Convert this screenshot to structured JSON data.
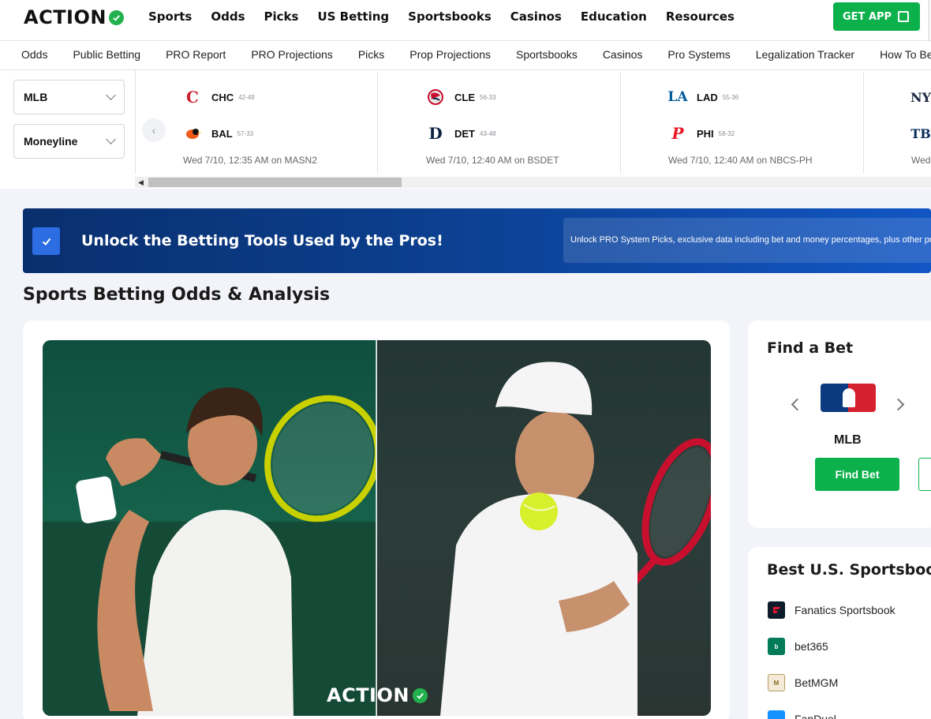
{
  "header": {
    "logo": "ACTION",
    "nav": [
      "Sports",
      "Odds",
      "Picks",
      "US Betting",
      "Sportsbooks",
      "Casinos",
      "Education",
      "Resources"
    ],
    "cta": "GET APP"
  },
  "subnav": [
    "Odds",
    "Public Betting",
    "PRO Report",
    "PRO Projections",
    "Picks",
    "Prop Projections",
    "Sportsbooks",
    "Casinos",
    "Pro Systems",
    "Legalization Tracker",
    "How To Bet"
  ],
  "scoreboard": {
    "league_select": "MLB",
    "market_select": "Moneyline",
    "games": [
      {
        "away": {
          "abbr": "CHC",
          "record": "42-49"
        },
        "home": {
          "abbr": "BAL",
          "record": "57-33"
        },
        "time": "Wed 7/10, 12:35 AM on MASN2"
      },
      {
        "away": {
          "abbr": "CLE",
          "record": "56-33"
        },
        "home": {
          "abbr": "DET",
          "record": "43-48"
        },
        "time": "Wed 7/10, 12:40 AM on BSDET"
      },
      {
        "away": {
          "abbr": "LAD",
          "record": "55-36"
        },
        "home": {
          "abbr": "PHI",
          "record": "58-32"
        },
        "time": "Wed 7/10, 12:40 AM on NBCS-PH"
      },
      {
        "time_partial": "Wed"
      }
    ]
  },
  "banner": {
    "title": "Unlock the Betting Tools Used by the Pros!",
    "description": "Unlock PRO System Picks, exclusive data including bet and money percentages, plus other premium"
  },
  "section_title": "Sports Betting Odds & Analysis",
  "hero": {
    "watermark": "ACTION"
  },
  "find_bet": {
    "title": "Find a Bet",
    "league": "MLB",
    "button": "Find Bet"
  },
  "best_books": {
    "title": "Best U.S. Sportsbooks",
    "items": [
      "Fanatics Sportsbook",
      "bet365",
      "BetMGM",
      "FanDuel"
    ]
  },
  "colors": {
    "accent_green": "#0cb14b",
    "banner_blue": "#0b3d8a",
    "brand_check": "#23b14d"
  }
}
